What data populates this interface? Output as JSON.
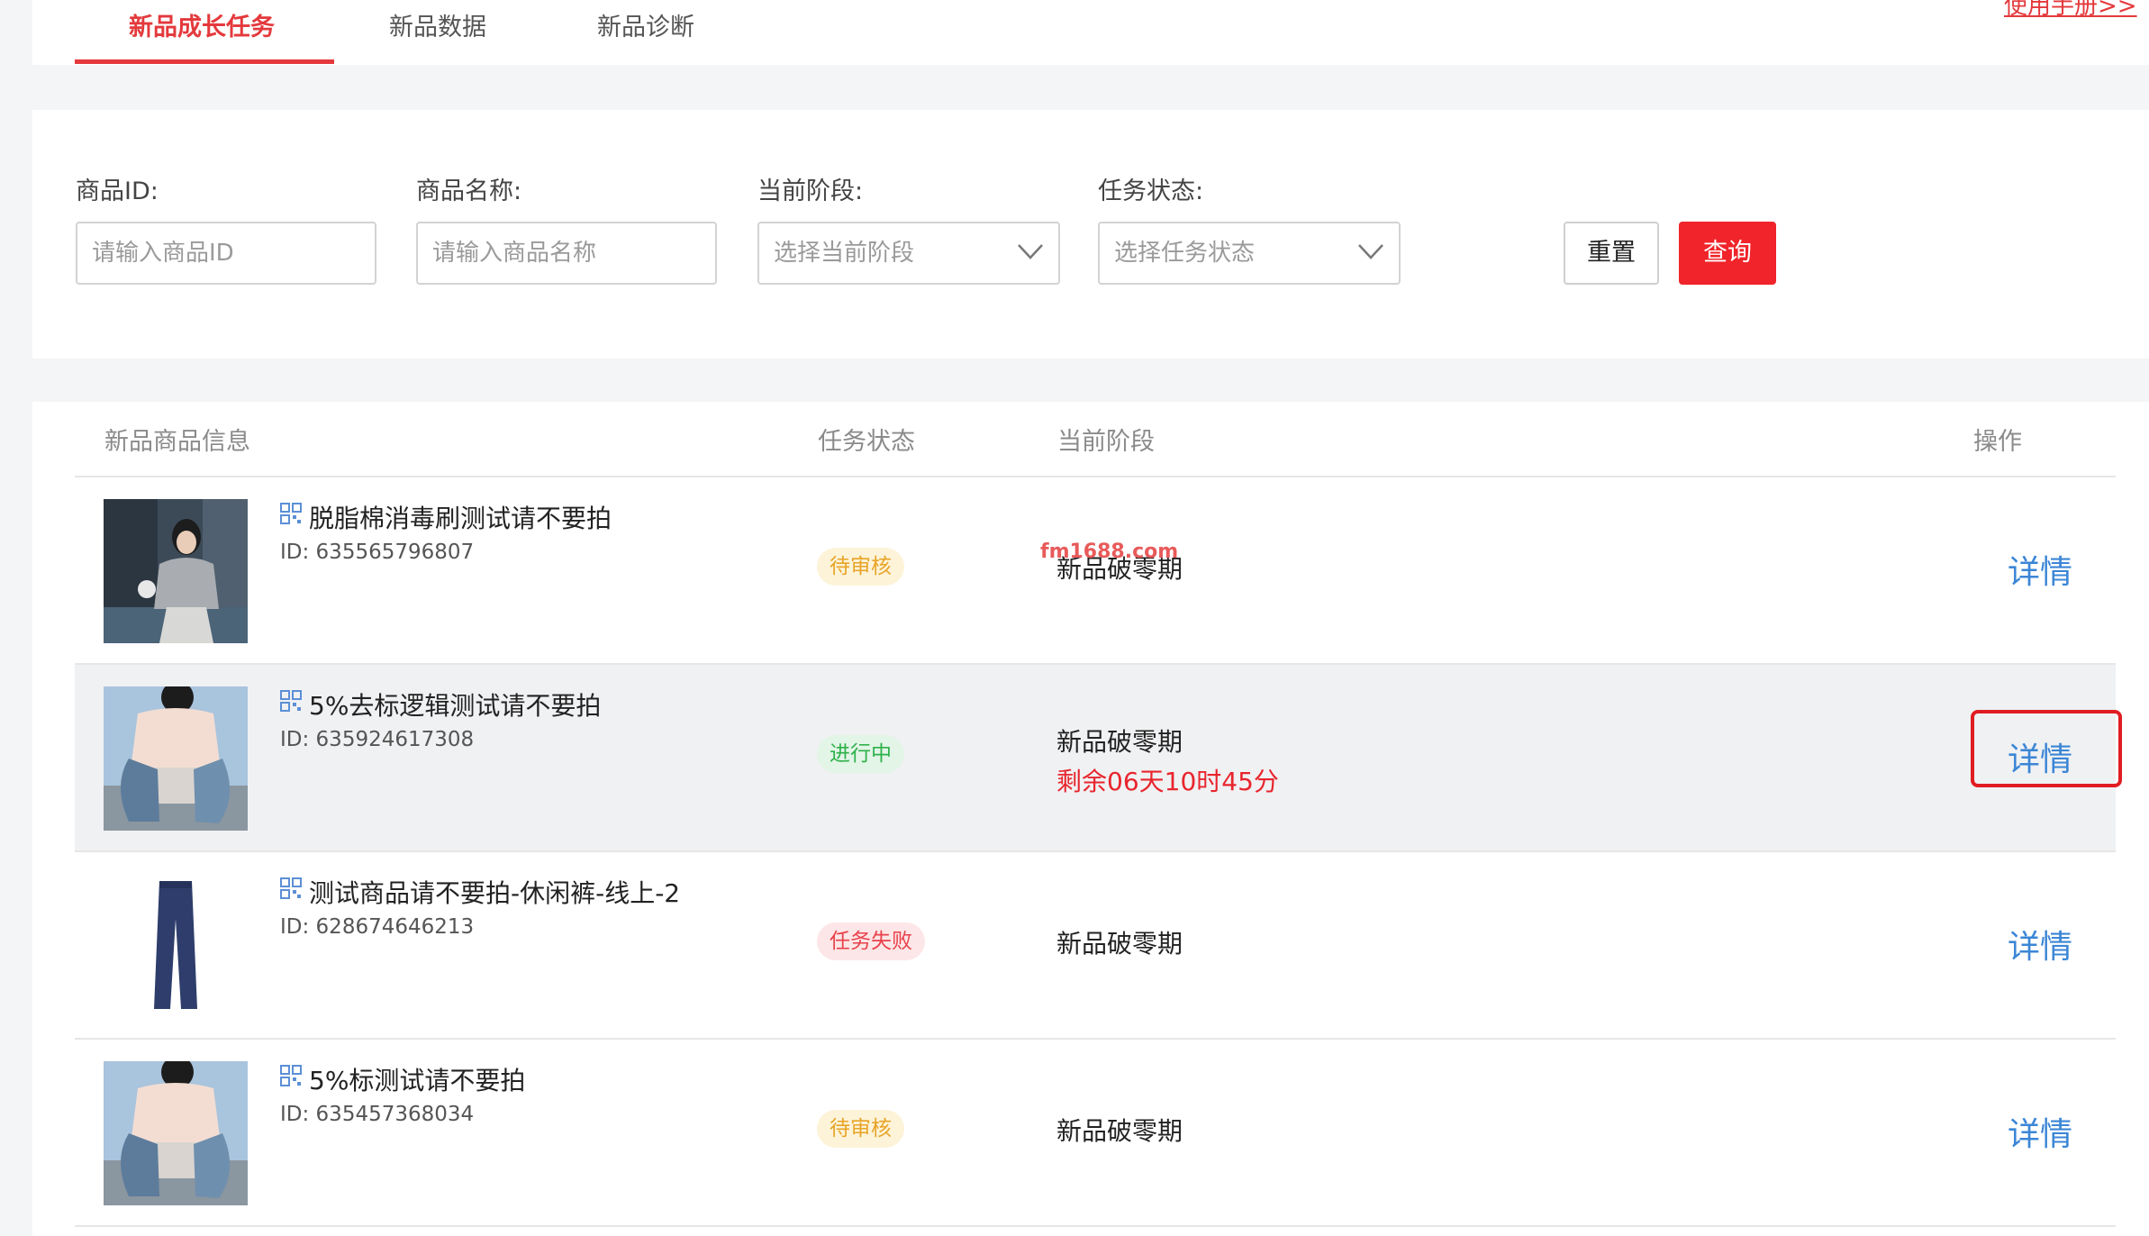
{
  "tabs": [
    "新品成长任务",
    "新品数据",
    "新品诊断"
  ],
  "manual_link": "使用手册>>",
  "filters": {
    "product_id_label": "商品ID:",
    "product_id_placeholder": "请输入商品ID",
    "product_name_label": "商品名称:",
    "product_name_placeholder": "请输入商品名称",
    "stage_label": "当前阶段:",
    "stage_placeholder": "选择当前阶段",
    "status_label": "任务状态:",
    "status_placeholder": "选择任务状态",
    "reset": "重置",
    "query": "查询"
  },
  "table": {
    "headers": {
      "info": "新品商品信息",
      "status": "任务状态",
      "stage": "当前阶段",
      "action": "操作"
    },
    "rows": [
      {
        "name": "脱脂棉消毒刷测试请不要拍",
        "id": "ID: 635565796807",
        "status": "待审核",
        "stage": "新品破零期",
        "remaining": "",
        "action": "详情"
      },
      {
        "name": "5%去标逻辑测试请不要拍",
        "id": "ID: 635924617308",
        "status": "进行中",
        "stage": "新品破零期",
        "remaining": "剩余06天10时45分",
        "action": "详情"
      },
      {
        "name": "测试商品请不要拍-休闲裤-线上-2",
        "id": "ID: 628674646213",
        "status": "任务失败",
        "stage": "新品破零期",
        "remaining": "",
        "action": "详情"
      },
      {
        "name": "5%标测试请不要拍",
        "id": "ID: 635457368034",
        "status": "待审核",
        "stage": "新品破零期",
        "remaining": "",
        "action": "详情"
      }
    ]
  },
  "watermark": "fm1688.com",
  "colors": {
    "accent_red": "#e4393c",
    "link_blue": "#3b86d6"
  }
}
